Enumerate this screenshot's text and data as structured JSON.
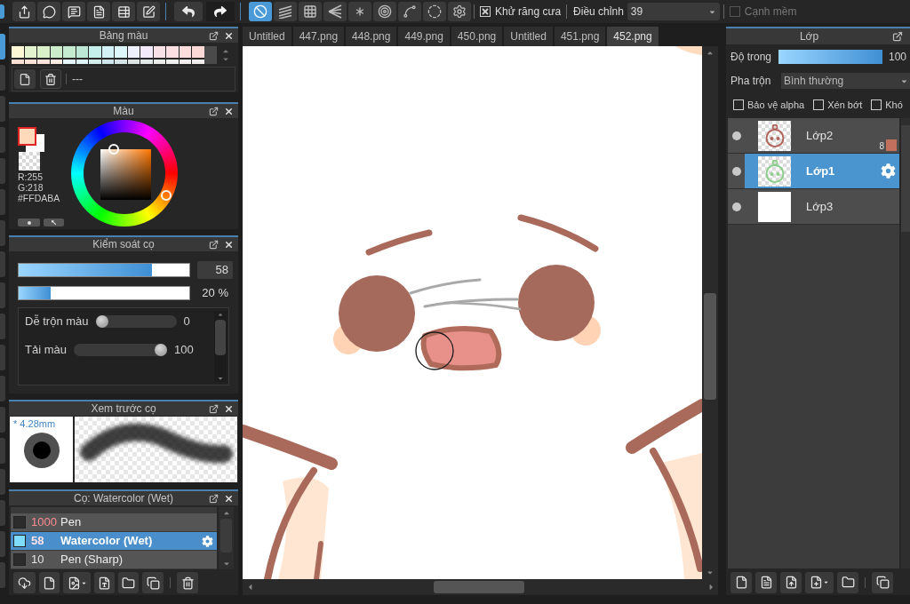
{
  "toolbar": {
    "ruler_tools": [
      {
        "selected": true
      },
      {
        "selected": false
      },
      {
        "selected": false
      },
      {
        "selected": false
      },
      {
        "selected": false
      },
      {
        "selected": false
      },
      {
        "selected": false
      },
      {
        "selected": false
      },
      {
        "selected": false
      }
    ],
    "antialias": {
      "label": "Khử răng cưa",
      "checked": true
    },
    "correction": {
      "label": "Điều chỉnh",
      "value": "39"
    },
    "soft_edge": {
      "label": "Cạnh mềm",
      "checked": false,
      "disabled": true
    }
  },
  "tool_strip": [
    {
      "selected": true
    },
    {
      "selected": false
    },
    {
      "selected": false
    },
    {
      "selected": false
    },
    {
      "selected": false
    },
    {
      "selected": false
    },
    {
      "selected": false
    },
    {
      "selected": false
    },
    {
      "selected": false
    },
    {
      "selected": false
    },
    {
      "selected": false
    },
    {
      "selected": false
    },
    {
      "selected": false
    },
    {
      "selected": false
    },
    {
      "selected": false
    },
    {
      "selected": false
    },
    {
      "selected": false
    },
    {
      "selected": false
    }
  ],
  "palette": {
    "title": "Bảng màu",
    "swatches": [
      {
        "color": "#fdf7d6"
      },
      {
        "color": "#e3f3cf"
      },
      {
        "color": "#d9f0cb"
      },
      {
        "color": "#cdecc9"
      },
      {
        "color": "#c4ebcf"
      },
      {
        "color": "#bde8d6"
      },
      {
        "color": "#c5efeb"
      },
      {
        "color": "#d2f2f6"
      },
      {
        "color": "#dcf6fa"
      },
      {
        "color": "#eef0fb"
      },
      {
        "color": "#f3ebfb"
      },
      {
        "color": "#f9e1e8"
      },
      {
        "color": "#fbdfe2"
      },
      {
        "color": "#fcdcdc"
      },
      {
        "color": "#fcd9d6"
      }
    ],
    "swatches_row_2": [
      {
        "color": "#fbdfd2"
      },
      {
        "color": "#fbe3d8"
      },
      {
        "color": "#fde4dc"
      },
      {
        "color": "#fcece4"
      },
      {
        "color": "#e4f6f9"
      },
      {
        "color": "#dff4f6"
      },
      {
        "color": "#d4eeee"
      },
      {
        "color": "#cfe7ec"
      },
      {
        "color": "#d6e5e8"
      },
      {
        "color": "#dde5e5"
      },
      {
        "color": "#e2e8e8"
      },
      {
        "color": "#eaecea"
      },
      {
        "color": "#eeefef"
      },
      {
        "color": "#f3efee"
      },
      {
        "color": "#f1eded"
      }
    ],
    "name": "---"
  },
  "color": {
    "title": "Màu",
    "foreground": {
      "color": "#ffdaba"
    },
    "background": {
      "color": "#ffffff"
    },
    "red": "R:255",
    "green": "G:218",
    "hex": "#FFDABA"
  },
  "brush_control": {
    "title": "Kiểm soát cọ",
    "size": {
      "level": 0.78,
      "value": "58"
    },
    "opacity": {
      "level": 0.19,
      "reading": "20 %"
    },
    "params": [
      {
        "label": "Dễ trộn màu",
        "level": 0,
        "reading": "0"
      },
      {
        "label": "Tải màu",
        "level": 1,
        "reading": "100"
      }
    ]
  },
  "brush_preview": {
    "title": "Xem trước cọ",
    "size": "* 4.28mm"
  },
  "brushes": {
    "title": "Cọ: Watercolor (Wet)",
    "items": [
      {
        "size": "1000",
        "name": "Pen",
        "color": "#2c2c2c",
        "selected": false,
        "size_highlighted": true
      },
      {
        "size": "58",
        "name": "Watercolor (Wet)",
        "color": "#80dcff",
        "selected": true,
        "size_highlighted": true
      },
      {
        "size": "10",
        "name": "Pen (Sharp)",
        "color": "#2c2c2c",
        "selected": false,
        "size_highlighted": false
      }
    ]
  },
  "tabs": [
    {
      "label": "Untitled",
      "selected": false
    },
    {
      "label": "447.png",
      "selected": false
    },
    {
      "label": "448.png",
      "selected": false
    },
    {
      "label": "449.png",
      "selected": false
    },
    {
      "label": "450.png",
      "selected": false
    },
    {
      "label": "Untitled",
      "selected": false
    },
    {
      "label": "451.png",
      "selected": false
    },
    {
      "label": "452.png",
      "selected": true
    }
  ],
  "layers": {
    "title": "Lớp",
    "opacity": {
      "label": "Độ trong",
      "level": 1,
      "reading": "100"
    },
    "blend": {
      "label": "Pha trộn",
      "value": "Bình thường"
    },
    "options": [
      {
        "label": "Bảo vệ alpha",
        "checked": false
      },
      {
        "label": "Xén bớt",
        "checked": false
      },
      {
        "label": "Khó",
        "checked": false
      }
    ],
    "items": [
      {
        "name": "Lớp2",
        "selected": false,
        "visible": true,
        "kind": "transparent",
        "color": "#b0645a",
        "badge": {
          "label": "8",
          "color": "#c0705c"
        }
      },
      {
        "name": "Lớp1",
        "selected": true,
        "visible": true,
        "kind": "transparent",
        "color": "#8ccf8c"
      },
      {
        "name": "Lớp3",
        "selected": false,
        "visible": true,
        "kind": "opaque"
      }
    ]
  }
}
